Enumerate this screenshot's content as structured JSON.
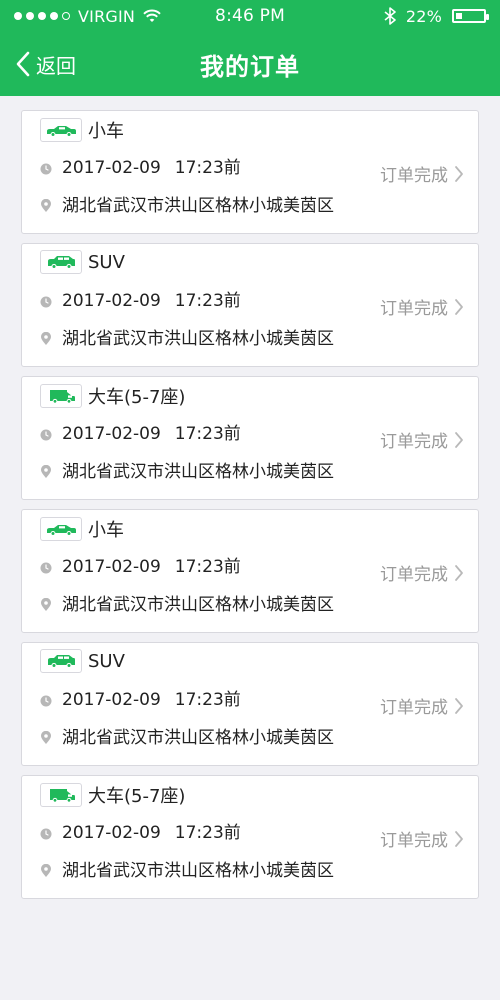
{
  "status_bar": {
    "carrier": "VIRGIN",
    "time": "8:46 PM",
    "battery_percent": "22%",
    "battery_level": 0.22
  },
  "header": {
    "back_label": "返回",
    "title": "我的订单"
  },
  "orders": [
    {
      "car_type": "小车",
      "car_icon": "car-icon",
      "datetime": "2017-02-09",
      "time": "17:23前",
      "address": "湖北省武汉市洪山区格林小城美茵区",
      "status": "订单完成"
    },
    {
      "car_type": "SUV",
      "car_icon": "suv-icon",
      "datetime": "2017-02-09",
      "time": "17:23前",
      "address": "湖北省武汉市洪山区格林小城美茵区",
      "status": "订单完成"
    },
    {
      "car_type": "大车(5-7座)",
      "car_icon": "van-icon",
      "datetime": "2017-02-09",
      "time": "17:23前",
      "address": "湖北省武汉市洪山区格林小城美茵区",
      "status": "订单完成"
    },
    {
      "car_type": "小车",
      "car_icon": "car-icon",
      "datetime": "2017-02-09",
      "time": "17:23前",
      "address": "湖北省武汉市洪山区格林小城美茵区",
      "status": "订单完成"
    },
    {
      "car_type": "SUV",
      "car_icon": "suv-icon",
      "datetime": "2017-02-09",
      "time": "17:23前",
      "address": "湖北省武汉市洪山区格林小城美茵区",
      "status": "订单完成"
    },
    {
      "car_type": "大车(5-7座)",
      "car_icon": "van-icon",
      "datetime": "2017-02-09",
      "time": "17:23前",
      "address": "湖北省武汉市洪山区格林小城美茵区",
      "status": "订单完成"
    }
  ],
  "colors": {
    "brand_green": "#20B95B",
    "background": "#F1F1F5",
    "muted_text": "#9A9A9A"
  }
}
